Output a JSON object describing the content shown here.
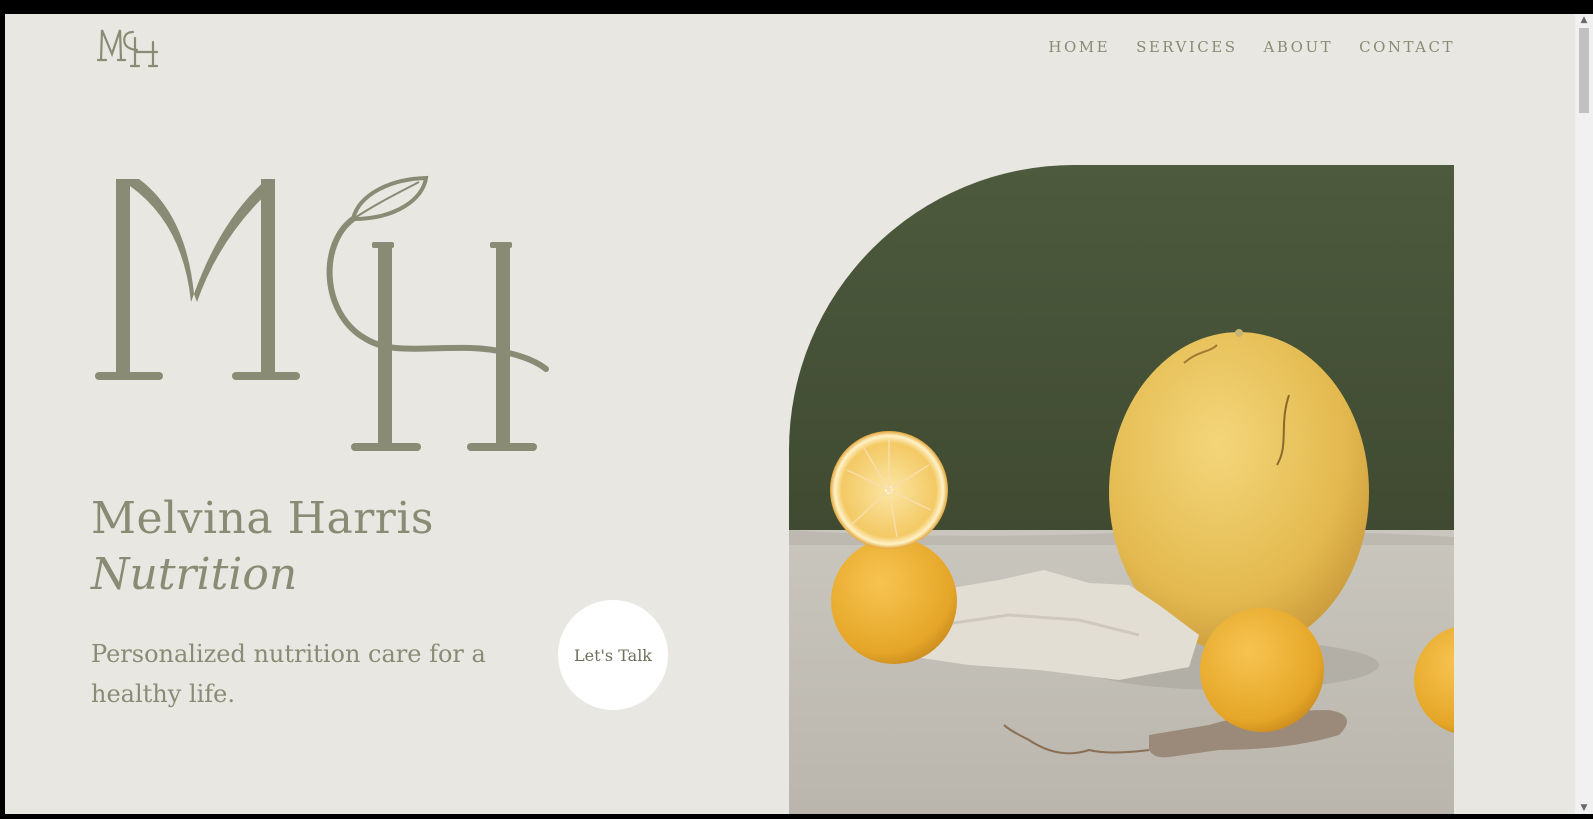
{
  "brand": {
    "monogram_small": "MH",
    "name_line1": "Melvina Harris",
    "name_line2": "Nutrition"
  },
  "nav": {
    "items": [
      "HOME",
      "SERVICES",
      "ABOUT",
      "CONTACT"
    ]
  },
  "hero": {
    "tagline": "Personalized nutrition care for a healthy life.",
    "cta_label": "Let's Talk",
    "image_subject": "still-life-lemons-melon-photo"
  },
  "colors": {
    "background": "#e8e7e2",
    "accent": "#8a8b74",
    "photo_backdrop": "#4b5639",
    "cta_bg": "#ffffff"
  }
}
